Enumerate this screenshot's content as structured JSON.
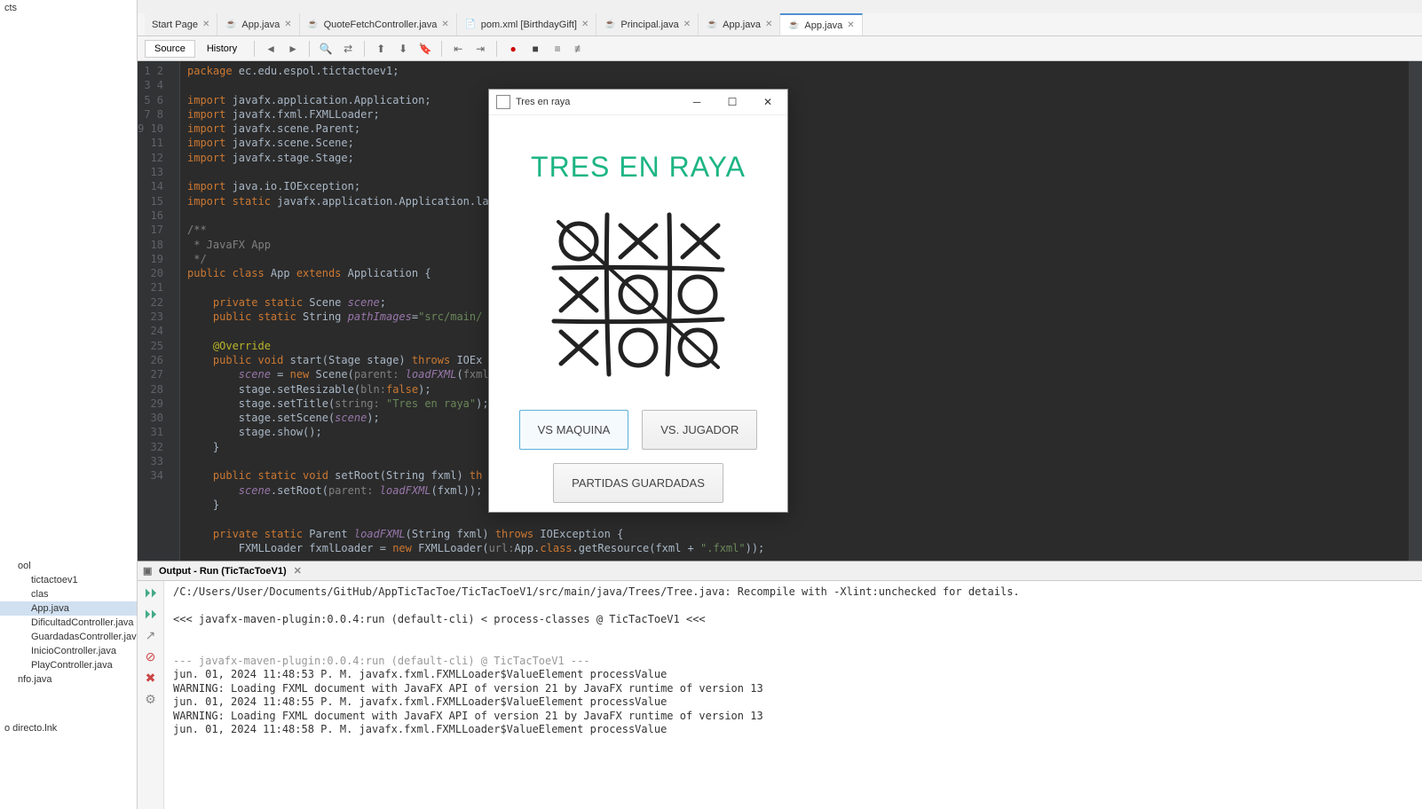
{
  "sidebar": {
    "top_label": "cts",
    "items": [
      {
        "label": "ool",
        "indent": false
      },
      {
        "label": "tictactoev1",
        "indent": true
      },
      {
        "label": "clas",
        "indent": true
      },
      {
        "label": "App.java",
        "indent": true,
        "selected": true
      },
      {
        "label": "DificultadController.java",
        "indent": true
      },
      {
        "label": "GuardadasController.java",
        "indent": true
      },
      {
        "label": "InicioController.java",
        "indent": true
      },
      {
        "label": "PlayController.java",
        "indent": true
      },
      {
        "label": "nfo.java",
        "indent": false
      }
    ],
    "bottom": "o directo.lnk"
  },
  "tabs": [
    {
      "label": "Start Page",
      "icon": "",
      "active": false
    },
    {
      "label": "App.java",
      "icon": "java",
      "active": false
    },
    {
      "label": "QuoteFetchController.java",
      "icon": "java",
      "active": false
    },
    {
      "label": "pom.xml [BirthdayGift]",
      "icon": "xml",
      "active": false
    },
    {
      "label": "Principal.java",
      "icon": "java",
      "active": false
    },
    {
      "label": "App.java",
      "icon": "java",
      "active": false
    },
    {
      "label": "App.java",
      "icon": "java",
      "active": true
    }
  ],
  "editor_toolbar": {
    "source": "Source",
    "history": "History"
  },
  "code_lines": [
    [
      {
        "t": "package ",
        "c": "kw"
      },
      {
        "t": "ec.edu.espol.tictactoev1;"
      }
    ],
    [],
    [
      {
        "t": "import ",
        "c": "kw"
      },
      {
        "t": "javafx.application.Application;"
      }
    ],
    [
      {
        "t": "import ",
        "c": "kw"
      },
      {
        "t": "javafx.fxml.FXMLLoader;"
      }
    ],
    [
      {
        "t": "import ",
        "c": "kw"
      },
      {
        "t": "javafx.scene.Parent;"
      }
    ],
    [
      {
        "t": "import ",
        "c": "kw"
      },
      {
        "t": "javafx.scene.Scene;"
      }
    ],
    [
      {
        "t": "import ",
        "c": "kw"
      },
      {
        "t": "javafx.stage.Stage;"
      }
    ],
    [],
    [
      {
        "t": "import ",
        "c": "kw"
      },
      {
        "t": "java.io.IOException;"
      }
    ],
    [
      {
        "t": "import static ",
        "c": "kw"
      },
      {
        "t": "javafx.application.Application.la"
      }
    ],
    [],
    [
      {
        "t": "/**",
        "c": "com"
      }
    ],
    [
      {
        "t": " * JavaFX App",
        "c": "com"
      }
    ],
    [
      {
        "t": " */",
        "c": "com"
      }
    ],
    [
      {
        "t": "public class ",
        "c": "kw"
      },
      {
        "t": "App "
      },
      {
        "t": "extends ",
        "c": "kw"
      },
      {
        "t": "Application {"
      }
    ],
    [],
    [
      {
        "t": "    private static ",
        "c": "kw"
      },
      {
        "t": "Scene "
      },
      {
        "t": "scene",
        "c": "field"
      },
      {
        "t": ";"
      }
    ],
    [
      {
        "t": "    public static ",
        "c": "kw"
      },
      {
        "t": "String "
      },
      {
        "t": "pathImages",
        "c": "field"
      },
      {
        "t": "="
      },
      {
        "t": "\"src/main/",
        "c": "str"
      }
    ],
    [],
    [
      {
        "t": "    @Override",
        "c": "ann"
      }
    ],
    [
      {
        "t": "    public void ",
        "c": "kw"
      },
      {
        "t": "start"
      },
      {
        "t": "(Stage stage) "
      },
      {
        "t": "throws ",
        "c": "kw"
      },
      {
        "t": "IOEx"
      }
    ],
    [
      {
        "t": "        scene",
        "c": "field"
      },
      {
        "t": " = "
      },
      {
        "t": "new ",
        "c": "kw"
      },
      {
        "t": "Scene("
      },
      {
        "t": "parent: ",
        "c": "param"
      },
      {
        "t": "loadFXML",
        "c": "field"
      },
      {
        "t": "("
      },
      {
        "t": "fxml: ",
        "c": "param"
      },
      {
        "t": "\"",
        "c": "str"
      }
    ],
    [
      {
        "t": "        stage.setResizable("
      },
      {
        "t": "bln:",
        "c": "param"
      },
      {
        "t": "false",
        "c": "kw"
      },
      {
        "t": ");"
      }
    ],
    [
      {
        "t": "        stage.setTitle("
      },
      {
        "t": "string: ",
        "c": "param"
      },
      {
        "t": "\"Tres en raya\"",
        "c": "str"
      },
      {
        "t": ");"
      }
    ],
    [
      {
        "t": "        stage.setScene("
      },
      {
        "t": "scene",
        "c": "field"
      },
      {
        "t": ");"
      }
    ],
    [
      {
        "t": "        stage.show();"
      }
    ],
    [
      {
        "t": "    }"
      }
    ],
    [],
    [
      {
        "t": "    public static void ",
        "c": "kw"
      },
      {
        "t": "setRoot"
      },
      {
        "t": "(String fxml) "
      },
      {
        "t": "th",
        "c": "kw"
      }
    ],
    [
      {
        "t": "        scene",
        "c": "field"
      },
      {
        "t": ".setRoot("
      },
      {
        "t": "parent: ",
        "c": "param"
      },
      {
        "t": "loadFXML",
        "c": "field"
      },
      {
        "t": "(fxml));"
      }
    ],
    [
      {
        "t": "    }"
      }
    ],
    [],
    [
      {
        "t": "    private static ",
        "c": "kw"
      },
      {
        "t": "Parent "
      },
      {
        "t": "loadFXML",
        "c": "field"
      },
      {
        "t": "(String fxml) "
      },
      {
        "t": "throws ",
        "c": "kw"
      },
      {
        "t": "IOException {"
      }
    ],
    [
      {
        "t": "        FXMLLoader fxmlLoader = "
      },
      {
        "t": "new ",
        "c": "kw"
      },
      {
        "t": "FXMLLoader("
      },
      {
        "t": "url:",
        "c": "param"
      },
      {
        "t": "App."
      },
      {
        "t": "class",
        "c": "kw"
      },
      {
        "t": ".getResource(fxml + "
      },
      {
        "t": "\".fxml\"",
        "c": "str"
      },
      {
        "t": "));"
      }
    ]
  ],
  "output": {
    "title": "Output - Run (TicTacToeV1)",
    "lines": [
      {
        "text": "/C:/Users/User/Documents/GitHub/AppTicTacToe/TicTacToeV1/src/main/java/Trees/Tree.java: Recompile with -Xlint:unchecked for details."
      },
      {
        "text": ""
      },
      {
        "text": "<<< javafx-maven-plugin:0.0.4:run (default-cli) < process-classes @ TicTacToeV1 <<<"
      },
      {
        "text": ""
      },
      {
        "text": ""
      },
      {
        "text": "--- javafx-maven-plugin:0.0.4:run (default-cli) @ TicTacToeV1 ---",
        "cls": "out-gray"
      },
      {
        "text": "jun. 01, 2024 11:48:53 P. M. javafx.fxml.FXMLLoader$ValueElement processValue"
      },
      {
        "text": "WARNING: Loading FXML document with JavaFX API of version 21 by JavaFX runtime of version 13"
      },
      {
        "text": "jun. 01, 2024 11:48:55 P. M. javafx.fxml.FXMLLoader$ValueElement processValue"
      },
      {
        "text": "WARNING: Loading FXML document with JavaFX API of version 21 by JavaFX runtime of version 13"
      },
      {
        "text": "jun. 01, 2024 11:48:58 P. M. javafx.fxml.FXMLLoader$ValueElement processValue"
      }
    ]
  },
  "app": {
    "title": "Tres en raya",
    "heading": "TRES EN RAYA",
    "btn_vs_machine": "VS MAQUINA",
    "btn_vs_player": "VS. JUGADOR",
    "btn_saved": "PARTIDAS GUARDADAS"
  }
}
